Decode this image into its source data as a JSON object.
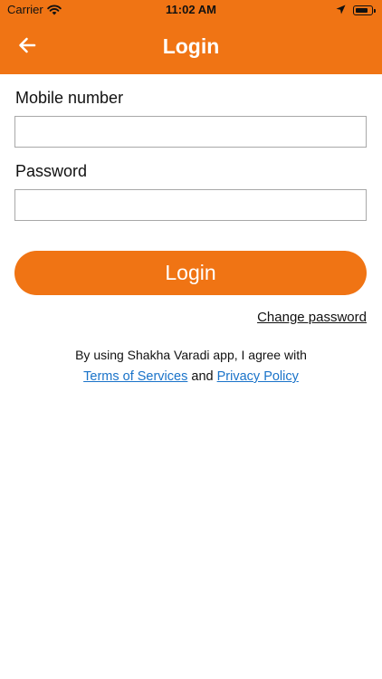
{
  "status_bar": {
    "carrier": "Carrier",
    "time": "11:02 AM"
  },
  "nav": {
    "title": "Login"
  },
  "form": {
    "mobile_label": "Mobile number",
    "mobile_value": "",
    "password_label": "Password",
    "password_value": "",
    "login_label": "Login",
    "change_password": "Change password"
  },
  "legal": {
    "agree_text": "By using Shakha Varadi app, I agree with",
    "terms_link": "Terms of Services",
    "and_text": "and",
    "privacy_link": "Privacy Policy"
  },
  "colors": {
    "brand_orange": "#f07414",
    "link_blue": "#1a73c9"
  },
  "icons": {
    "back": "arrow-left-icon",
    "wifi": "wifi-icon",
    "location": "location-arrow-icon",
    "battery": "battery-icon"
  }
}
